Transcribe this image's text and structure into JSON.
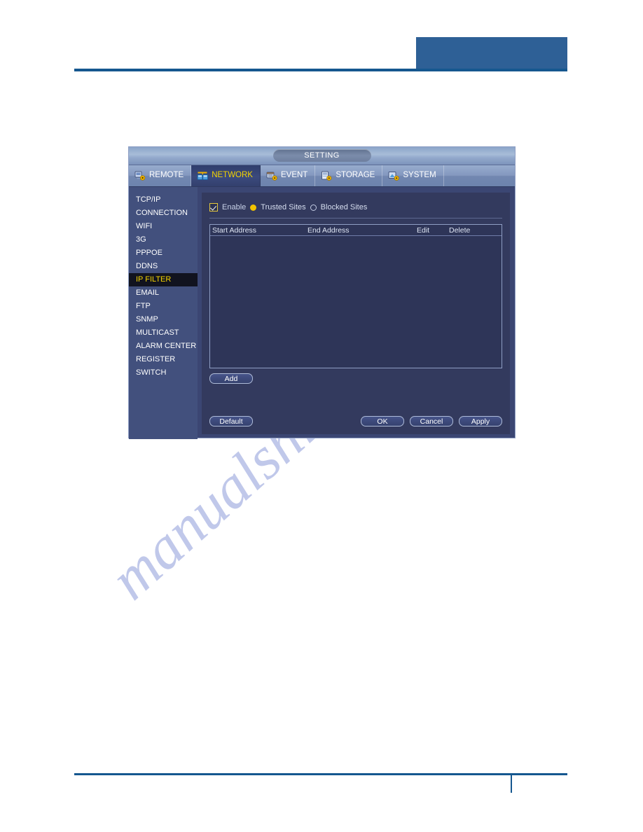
{
  "document": {
    "header_block_color": "#2e6096",
    "rule_color": "#15578f",
    "watermark_text": "manualshive.com"
  },
  "dialog": {
    "title": "SETTING",
    "tabs": [
      {
        "label": "REMOTE",
        "icon": "remote-gear-icon",
        "active": false
      },
      {
        "label": "NETWORK",
        "icon": "network-icon",
        "active": true
      },
      {
        "label": "EVENT",
        "icon": "event-gear-icon",
        "active": false
      },
      {
        "label": "STORAGE",
        "icon": "storage-gear-icon",
        "active": false
      },
      {
        "label": "SYSTEM",
        "icon": "system-gear-icon",
        "active": false
      }
    ],
    "sidebar": {
      "items": [
        {
          "label": "TCP/IP",
          "active": false
        },
        {
          "label": "CONNECTION",
          "active": false
        },
        {
          "label": "WIFI",
          "active": false
        },
        {
          "label": "3G",
          "active": false
        },
        {
          "label": "PPPOE",
          "active": false
        },
        {
          "label": "DDNS",
          "active": false
        },
        {
          "label": "IP FILTER",
          "active": true
        },
        {
          "label": "EMAIL",
          "active": false
        },
        {
          "label": "FTP",
          "active": false
        },
        {
          "label": "SNMP",
          "active": false
        },
        {
          "label": "MULTICAST",
          "active": false
        },
        {
          "label": "ALARM CENTER",
          "active": false
        },
        {
          "label": "REGISTER",
          "active": false
        },
        {
          "label": "SWITCH",
          "active": false
        }
      ]
    },
    "content": {
      "enable_label": "Enable",
      "enable_checked": true,
      "site_mode_selected": "Trusted Sites",
      "radio_trusted_label": "Trusted Sites",
      "radio_blocked_label": "Blocked Sites",
      "table": {
        "columns": [
          "Start Address",
          "End Address",
          "Edit",
          "Delete"
        ],
        "rows": []
      },
      "add_label": "Add"
    },
    "actions": {
      "default_label": "Default",
      "ok_label": "OK",
      "cancel_label": "Cancel",
      "apply_label": "Apply"
    },
    "colors": {
      "dialog_bg": "#3b4673",
      "sidebar_bg": "#42507d",
      "content_bg": "#333a5e",
      "table_bg": "#2e3558",
      "accent_yellow": "#f5d400",
      "active_item_bg": "#11131f"
    }
  }
}
